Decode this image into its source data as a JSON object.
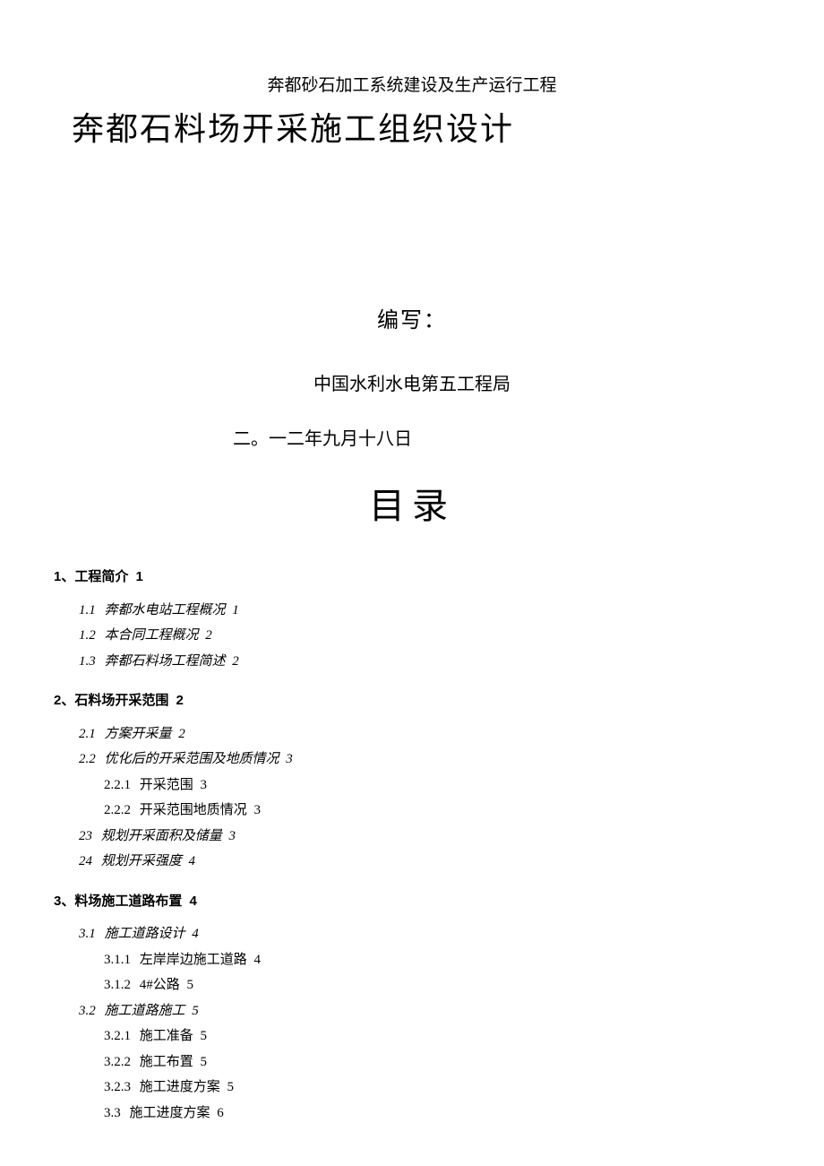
{
  "header": {
    "subtitle": "奔都砂石加工系统建设及生产运行工程",
    "title": "奔都石料场开采施工组织设计",
    "author_label": "编写：",
    "org": "中国水利水电第五工程局",
    "date": "二。一二年九月十八日",
    "toc_title": "目录"
  },
  "toc": {
    "s1": {
      "label": "1、工程简介",
      "page": "1"
    },
    "s1_1": {
      "num": "1.1",
      "label": "奔都水电站工程概况",
      "page": "1"
    },
    "s1_2": {
      "num": "1.2",
      "label": "本合同工程概况",
      "page": "2"
    },
    "s1_3": {
      "num": "1.3",
      "label": "奔都石料场工程简述",
      "page": "2"
    },
    "s2": {
      "label": "2、石料场开采范围",
      "page": "2"
    },
    "s2_1": {
      "num": "2.1",
      "label": "方案开采量",
      "page": "2"
    },
    "s2_2": {
      "num": "2.2",
      "label": "优化后的开采范围及地质情况",
      "page": "3"
    },
    "s2_2_1": {
      "num": "2.2.1",
      "label": "开采范围",
      "page": "3"
    },
    "s2_2_2": {
      "num": "2.2.2",
      "label": "开采范围地质情况",
      "page": "3"
    },
    "s2_3": {
      "num": "23",
      "label": "规划开采面积及储量",
      "page": "3"
    },
    "s2_4": {
      "num": "24",
      "label": "规划开采强度",
      "page": "4"
    },
    "s3": {
      "label": "3、料场施工道路布置",
      "page": "4"
    },
    "s3_1": {
      "num": "3.1",
      "label": "施工道路设计",
      "page": "4"
    },
    "s3_1_1": {
      "num": "3.1.1",
      "label": "左岸岸边施工道路",
      "page": "4"
    },
    "s3_1_2": {
      "num": "3.1.2",
      "label": "4#公路",
      "page": "5"
    },
    "s3_2": {
      "num": "3.2",
      "label": "施工道路施工",
      "page": "5"
    },
    "s3_2_1": {
      "num": "3.2.1",
      "label": "施工准备",
      "page": "5"
    },
    "s3_2_2": {
      "num": "3.2.2",
      "label": "施工布置",
      "page": "5"
    },
    "s3_2_3": {
      "num": "3.2.3",
      "label": "施工进度方案",
      "page": "5"
    },
    "s3_3": {
      "num": "3.3",
      "label": "施工进度方案",
      "page": "6"
    }
  }
}
